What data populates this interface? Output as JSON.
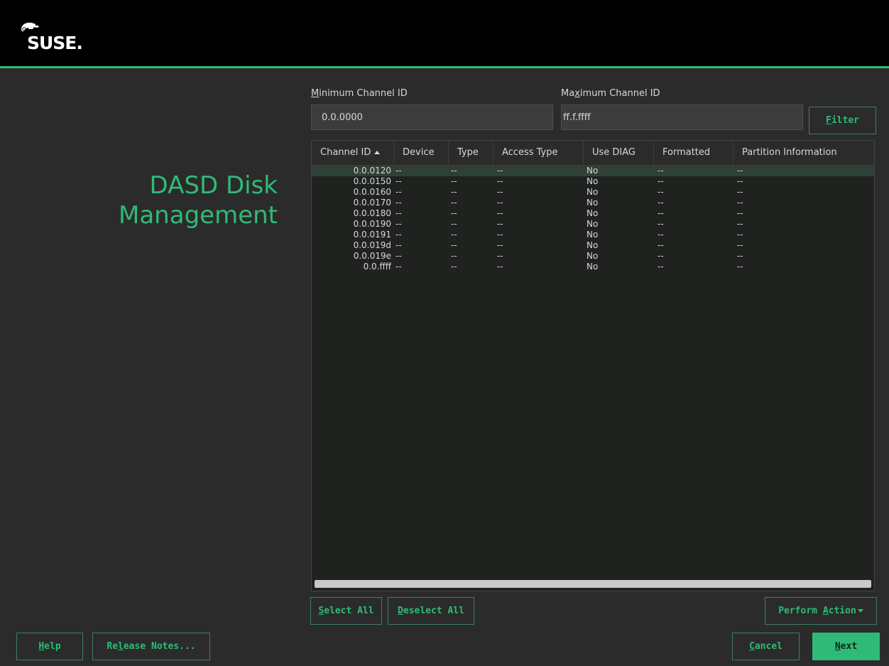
{
  "brand": {
    "logo_text": "SUSE."
  },
  "title": {
    "line1": "DASD Disk",
    "line2": "Management"
  },
  "filter": {
    "min_label_pre": "",
    "min_label_key": "M",
    "min_label_post": "inimum Channel ID",
    "min_value": "0.0.0000",
    "max_label_pre": "Ma",
    "max_label_key": "x",
    "max_label_post": "imum Channel ID",
    "max_value": "ff.f.ffff",
    "button_key": "F",
    "button_rest": "ilter"
  },
  "table": {
    "columns": [
      "Channel ID",
      "Device",
      "Type",
      "Access Type",
      "Use DIAG",
      "Formatted",
      "Partition Information"
    ],
    "sort_column": "Channel ID",
    "rows": [
      [
        "0.0.0120",
        "--",
        "--",
        "--",
        "No",
        "--",
        "--"
      ],
      [
        "0.0.0150",
        "--",
        "--",
        "--",
        "No",
        "--",
        "--"
      ],
      [
        "0.0.0160",
        "--",
        "--",
        "--",
        "No",
        "--",
        "--"
      ],
      [
        "0.0.0170",
        "--",
        "--",
        "--",
        "No",
        "--",
        "--"
      ],
      [
        "0.0.0180",
        "--",
        "--",
        "--",
        "No",
        "--",
        "--"
      ],
      [
        "0.0.0190",
        "--",
        "--",
        "--",
        "No",
        "--",
        "--"
      ],
      [
        "0.0.0191",
        "--",
        "--",
        "--",
        "No",
        "--",
        "--"
      ],
      [
        "0.0.019d",
        "--",
        "--",
        "--",
        "No",
        "--",
        "--"
      ],
      [
        "0.0.019e",
        "--",
        "--",
        "--",
        "No",
        "--",
        "--"
      ],
      [
        "0.0.ffff",
        "--",
        "--",
        "--",
        "No",
        "--",
        "--"
      ]
    ],
    "selected_row": 0
  },
  "actions": {
    "select_all_key": "S",
    "select_all_rest": "elect All",
    "deselect_all_key": "D",
    "deselect_all_rest": "eselect All",
    "perform_pre": "Perform ",
    "perform_key": "A",
    "perform_post": "ction"
  },
  "footer": {
    "help_key": "H",
    "help_rest": "elp",
    "release_pre": "Re",
    "release_key": "l",
    "release_post": "ease Notes...",
    "cancel_key": "C",
    "cancel_rest": "ancel",
    "next_key": "N",
    "next_rest": "ext"
  },
  "colors": {
    "accent": "#30ba78",
    "background": "#2b2b2b",
    "header_bg": "#000000"
  }
}
